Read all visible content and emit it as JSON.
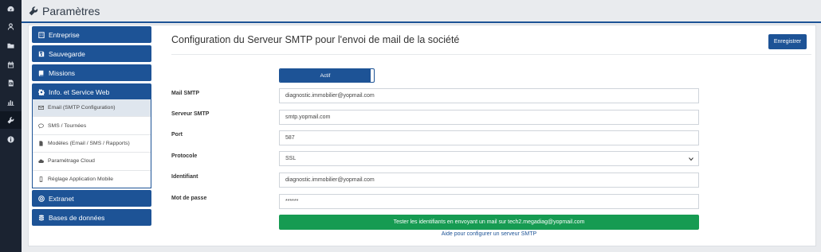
{
  "header": {
    "title": "Paramètres"
  },
  "menu": {
    "entreprise": "Entreprise",
    "sauvegarde": "Sauvegarde",
    "missions": "Missions",
    "info_web": "Info. et Service Web",
    "extranet": "Extranet",
    "bases": "Bases de données",
    "sub_items": [
      "Email (SMTP Configuration)",
      "SMS / Tournées",
      "Modèles (Email / SMS / Rapports)",
      "Paramétrage Cloud",
      "Réglage Application Mobile"
    ]
  },
  "main": {
    "title": "Configuration du Serveur SMTP pour l'envoi de mail de la société",
    "save_label": "Enregistrer",
    "toggle_label": "Actif",
    "fields": {
      "mail_smtp": {
        "label": "Mail SMTP",
        "value": "diagnostic.immobilier@yopmail.com"
      },
      "serveur_smtp": {
        "label": "Serveur SMTP",
        "value": "smtp.yopmail.com"
      },
      "port": {
        "label": "Port",
        "value": "587"
      },
      "protocole": {
        "label": "Protocole",
        "value": "SSL"
      },
      "identifiant": {
        "label": "Identifiant",
        "value": "diagnostic.immobilier@yopmail.com"
      },
      "mot_de_passe": {
        "label": "Mot de passe",
        "value": "******"
      }
    },
    "test_button": "Tester les identifiants en envoyant un mail sur tech2.megadiag@yopmail.com",
    "help_link": "Aide pour configurer un serveur SMTP"
  },
  "colors": {
    "primary": "#1d5396",
    "success": "#169b52",
    "rail": "#1b2331"
  }
}
